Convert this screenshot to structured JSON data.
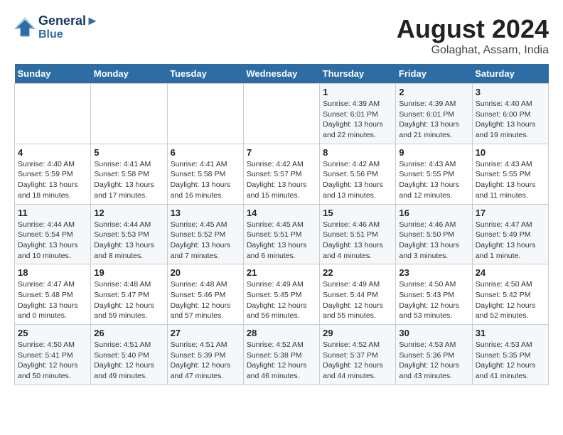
{
  "logo": {
    "line1": "General",
    "line2": "Blue"
  },
  "title": "August 2024",
  "location": "Golaghat, Assam, India",
  "days_of_week": [
    "Sunday",
    "Monday",
    "Tuesday",
    "Wednesday",
    "Thursday",
    "Friday",
    "Saturday"
  ],
  "weeks": [
    [
      {
        "day": "",
        "info": ""
      },
      {
        "day": "",
        "info": ""
      },
      {
        "day": "",
        "info": ""
      },
      {
        "day": "",
        "info": ""
      },
      {
        "day": "1",
        "info": "Sunrise: 4:39 AM\nSunset: 6:01 PM\nDaylight: 13 hours and 22 minutes."
      },
      {
        "day": "2",
        "info": "Sunrise: 4:39 AM\nSunset: 6:01 PM\nDaylight: 13 hours and 21 minutes."
      },
      {
        "day": "3",
        "info": "Sunrise: 4:40 AM\nSunset: 6:00 PM\nDaylight: 13 hours and 19 minutes."
      }
    ],
    [
      {
        "day": "4",
        "info": "Sunrise: 4:40 AM\nSunset: 5:59 PM\nDaylight: 13 hours and 18 minutes."
      },
      {
        "day": "5",
        "info": "Sunrise: 4:41 AM\nSunset: 5:58 PM\nDaylight: 13 hours and 17 minutes."
      },
      {
        "day": "6",
        "info": "Sunrise: 4:41 AM\nSunset: 5:58 PM\nDaylight: 13 hours and 16 minutes."
      },
      {
        "day": "7",
        "info": "Sunrise: 4:42 AM\nSunset: 5:57 PM\nDaylight: 13 hours and 15 minutes."
      },
      {
        "day": "8",
        "info": "Sunrise: 4:42 AM\nSunset: 5:56 PM\nDaylight: 13 hours and 13 minutes."
      },
      {
        "day": "9",
        "info": "Sunrise: 4:43 AM\nSunset: 5:55 PM\nDaylight: 13 hours and 12 minutes."
      },
      {
        "day": "10",
        "info": "Sunrise: 4:43 AM\nSunset: 5:55 PM\nDaylight: 13 hours and 11 minutes."
      }
    ],
    [
      {
        "day": "11",
        "info": "Sunrise: 4:44 AM\nSunset: 5:54 PM\nDaylight: 13 hours and 10 minutes."
      },
      {
        "day": "12",
        "info": "Sunrise: 4:44 AM\nSunset: 5:53 PM\nDaylight: 13 hours and 8 minutes."
      },
      {
        "day": "13",
        "info": "Sunrise: 4:45 AM\nSunset: 5:52 PM\nDaylight: 13 hours and 7 minutes."
      },
      {
        "day": "14",
        "info": "Sunrise: 4:45 AM\nSunset: 5:51 PM\nDaylight: 13 hours and 6 minutes."
      },
      {
        "day": "15",
        "info": "Sunrise: 4:46 AM\nSunset: 5:51 PM\nDaylight: 13 hours and 4 minutes."
      },
      {
        "day": "16",
        "info": "Sunrise: 4:46 AM\nSunset: 5:50 PM\nDaylight: 13 hours and 3 minutes."
      },
      {
        "day": "17",
        "info": "Sunrise: 4:47 AM\nSunset: 5:49 PM\nDaylight: 13 hours and 1 minute."
      }
    ],
    [
      {
        "day": "18",
        "info": "Sunrise: 4:47 AM\nSunset: 5:48 PM\nDaylight: 13 hours and 0 minutes."
      },
      {
        "day": "19",
        "info": "Sunrise: 4:48 AM\nSunset: 5:47 PM\nDaylight: 12 hours and 59 minutes."
      },
      {
        "day": "20",
        "info": "Sunrise: 4:48 AM\nSunset: 5:46 PM\nDaylight: 12 hours and 57 minutes."
      },
      {
        "day": "21",
        "info": "Sunrise: 4:49 AM\nSunset: 5:45 PM\nDaylight: 12 hours and 56 minutes."
      },
      {
        "day": "22",
        "info": "Sunrise: 4:49 AM\nSunset: 5:44 PM\nDaylight: 12 hours and 55 minutes."
      },
      {
        "day": "23",
        "info": "Sunrise: 4:50 AM\nSunset: 5:43 PM\nDaylight: 12 hours and 53 minutes."
      },
      {
        "day": "24",
        "info": "Sunrise: 4:50 AM\nSunset: 5:42 PM\nDaylight: 12 hours and 52 minutes."
      }
    ],
    [
      {
        "day": "25",
        "info": "Sunrise: 4:50 AM\nSunset: 5:41 PM\nDaylight: 12 hours and 50 minutes."
      },
      {
        "day": "26",
        "info": "Sunrise: 4:51 AM\nSunset: 5:40 PM\nDaylight: 12 hours and 49 minutes."
      },
      {
        "day": "27",
        "info": "Sunrise: 4:51 AM\nSunset: 5:39 PM\nDaylight: 12 hours and 47 minutes."
      },
      {
        "day": "28",
        "info": "Sunrise: 4:52 AM\nSunset: 5:38 PM\nDaylight: 12 hours and 46 minutes."
      },
      {
        "day": "29",
        "info": "Sunrise: 4:52 AM\nSunset: 5:37 PM\nDaylight: 12 hours and 44 minutes."
      },
      {
        "day": "30",
        "info": "Sunrise: 4:53 AM\nSunset: 5:36 PM\nDaylight: 12 hours and 43 minutes."
      },
      {
        "day": "31",
        "info": "Sunrise: 4:53 AM\nSunset: 5:35 PM\nDaylight: 12 hours and 41 minutes."
      }
    ]
  ]
}
